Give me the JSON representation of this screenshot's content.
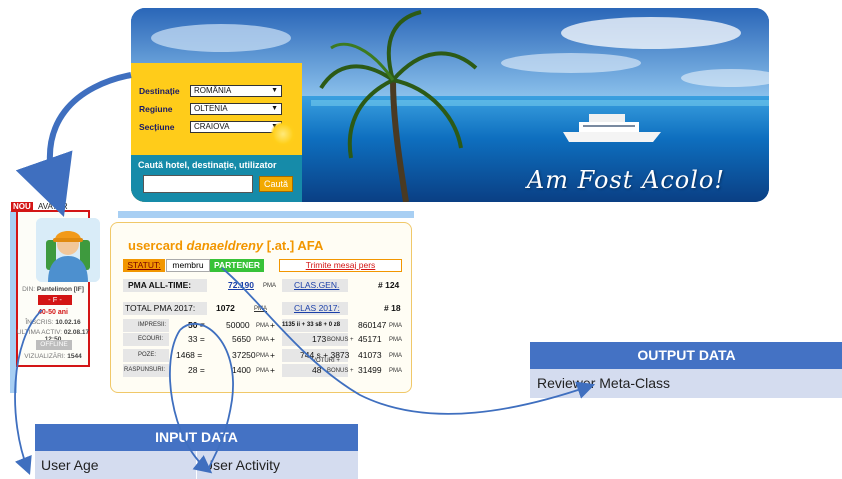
{
  "banner": {
    "title": "Am Fost Acolo!",
    "search": {
      "fields": [
        {
          "label": "Destinație",
          "value": "ROMÂNIA"
        },
        {
          "label": "Regiune",
          "value": "OLTENIA"
        },
        {
          "label": "Secțiune",
          "value": "CRAIOVA"
        }
      ],
      "caption": "Caută hotel, destinație, utilizator",
      "input_value": "",
      "button": "Caută"
    }
  },
  "avatar": {
    "new_tag": "NOU",
    "tag": "AVATAR",
    "location_prefix": "DIN:",
    "location": "Pantelimon [IF]",
    "gender": "- F -",
    "age": "40-50 ani",
    "registered_label": "ÎNSCRIS:",
    "registered": "10.02.16",
    "last_activity_label": "ULTIMA ACTIV:",
    "last_activity": "02.08.17 12:50",
    "status": "OFFLINE",
    "views_label": "VIZUALIZĂRI:",
    "views": "1544"
  },
  "usercard": {
    "title_prefix": "usercard",
    "username": "danaeldreny",
    "title_suffix": "[.at.] AFA",
    "statut_label": "STATUT:",
    "statut_value": "membru",
    "partner_badge": "PARTENER",
    "message_button": "Trimite mesaj pers",
    "pma_alltime_label": "PMA ALL-TIME:",
    "pma_alltime_value": "72.190",
    "pma_unit": "PMA",
    "clas_gen_label": "CLAS.GEN.",
    "clas_gen_value": "# 124",
    "total_label": "TOTAL PMA 2017:",
    "total_value": "1072",
    "clas_year_label": "CLAS 2017:",
    "clas_year_value": "# 18",
    "rows": [
      {
        "label": "IMPRESII:",
        "count": "50 =",
        "pma": "50000",
        "detail": "1135 ii + 33 s8 + 0 z8",
        "right": "860147"
      },
      {
        "label": "ECOURI:",
        "count": "33 =",
        "pma": "5650",
        "detail": "173",
        "detail_unit": "BONUS +",
        "right": "45171"
      },
      {
        "label": "POZE:",
        "count": "1468 =",
        "pma": "37250",
        "detail": "744 s + 3873",
        "detail_unit": "VOTURI +",
        "right": "41073"
      },
      {
        "label": "RASPUNSURI:",
        "count": "28 =",
        "pma": "1400",
        "detail": "48",
        "detail_unit": "BONUS +",
        "right": "31499"
      }
    ],
    "bonus_unit": "BONUS +",
    "plus": "+"
  },
  "output": {
    "header": "OUTPUT DATA",
    "cell": "Reviewer Meta-Class"
  },
  "input": {
    "header": "INPUT DATA",
    "cells": [
      "User Age",
      "User Activity"
    ]
  },
  "colors": {
    "arrow": "#3f6fbf",
    "table_header": "#4472c4",
    "table_cell": "#d4dcef",
    "accent": "#f29600",
    "badge_red": "#d31515",
    "badge_green": "#38c238"
  }
}
